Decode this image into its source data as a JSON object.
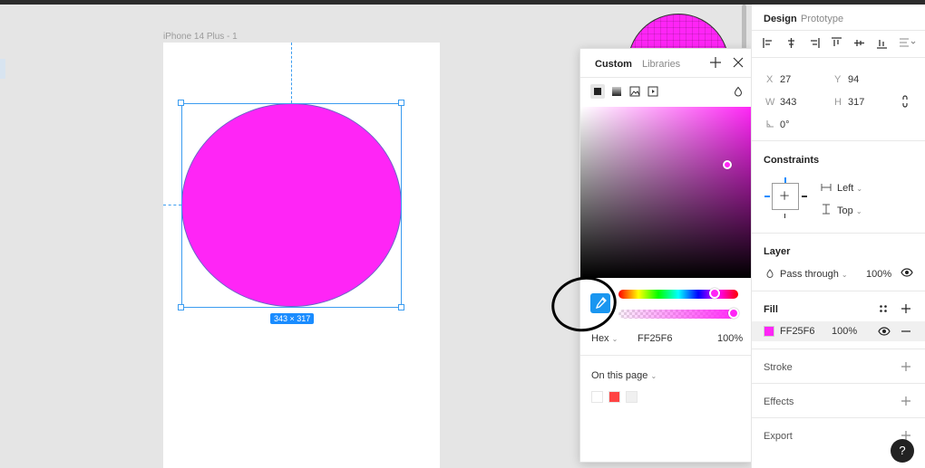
{
  "canvas": {
    "frame_label": "iPhone 14 Plus - 1",
    "size_badge": "343 × 317"
  },
  "picker": {
    "tabs": [
      "Custom",
      "Libraries"
    ],
    "fill_types": [
      "solid-fill-icon",
      "gradient-fill-icon",
      "image-fill-icon",
      "video-fill-icon"
    ],
    "color_mode": "Hex",
    "hex_value": "FF25F6",
    "opacity": "100%",
    "on_this_page_label": "On this page",
    "page_swatches": [
      "#ffffff",
      "#ff4444",
      "#f0f0f0"
    ],
    "hue_value": 0.89,
    "alpha_value": 1.0
  },
  "panel": {
    "tabs": [
      "Design",
      "Prototype"
    ],
    "x_label": "X",
    "x_value": "27",
    "y_label": "Y",
    "y_value": "94",
    "w_label": "W",
    "w_value": "343",
    "h_label": "H",
    "h_value": "317",
    "rotation_value": "0°",
    "constraints_title": "Constraints",
    "constraint_h": "Left",
    "constraint_v": "Top",
    "layer_title": "Layer",
    "blend_mode": "Pass through",
    "layer_opacity": "100%",
    "fill_title": "Fill",
    "fill_hex": "FF25F6",
    "fill_opacity": "100%",
    "fill_color": "#ff25f6",
    "stroke_title": "Stroke",
    "effects_title": "Effects",
    "export_title": "Export",
    "help_label": "?"
  }
}
